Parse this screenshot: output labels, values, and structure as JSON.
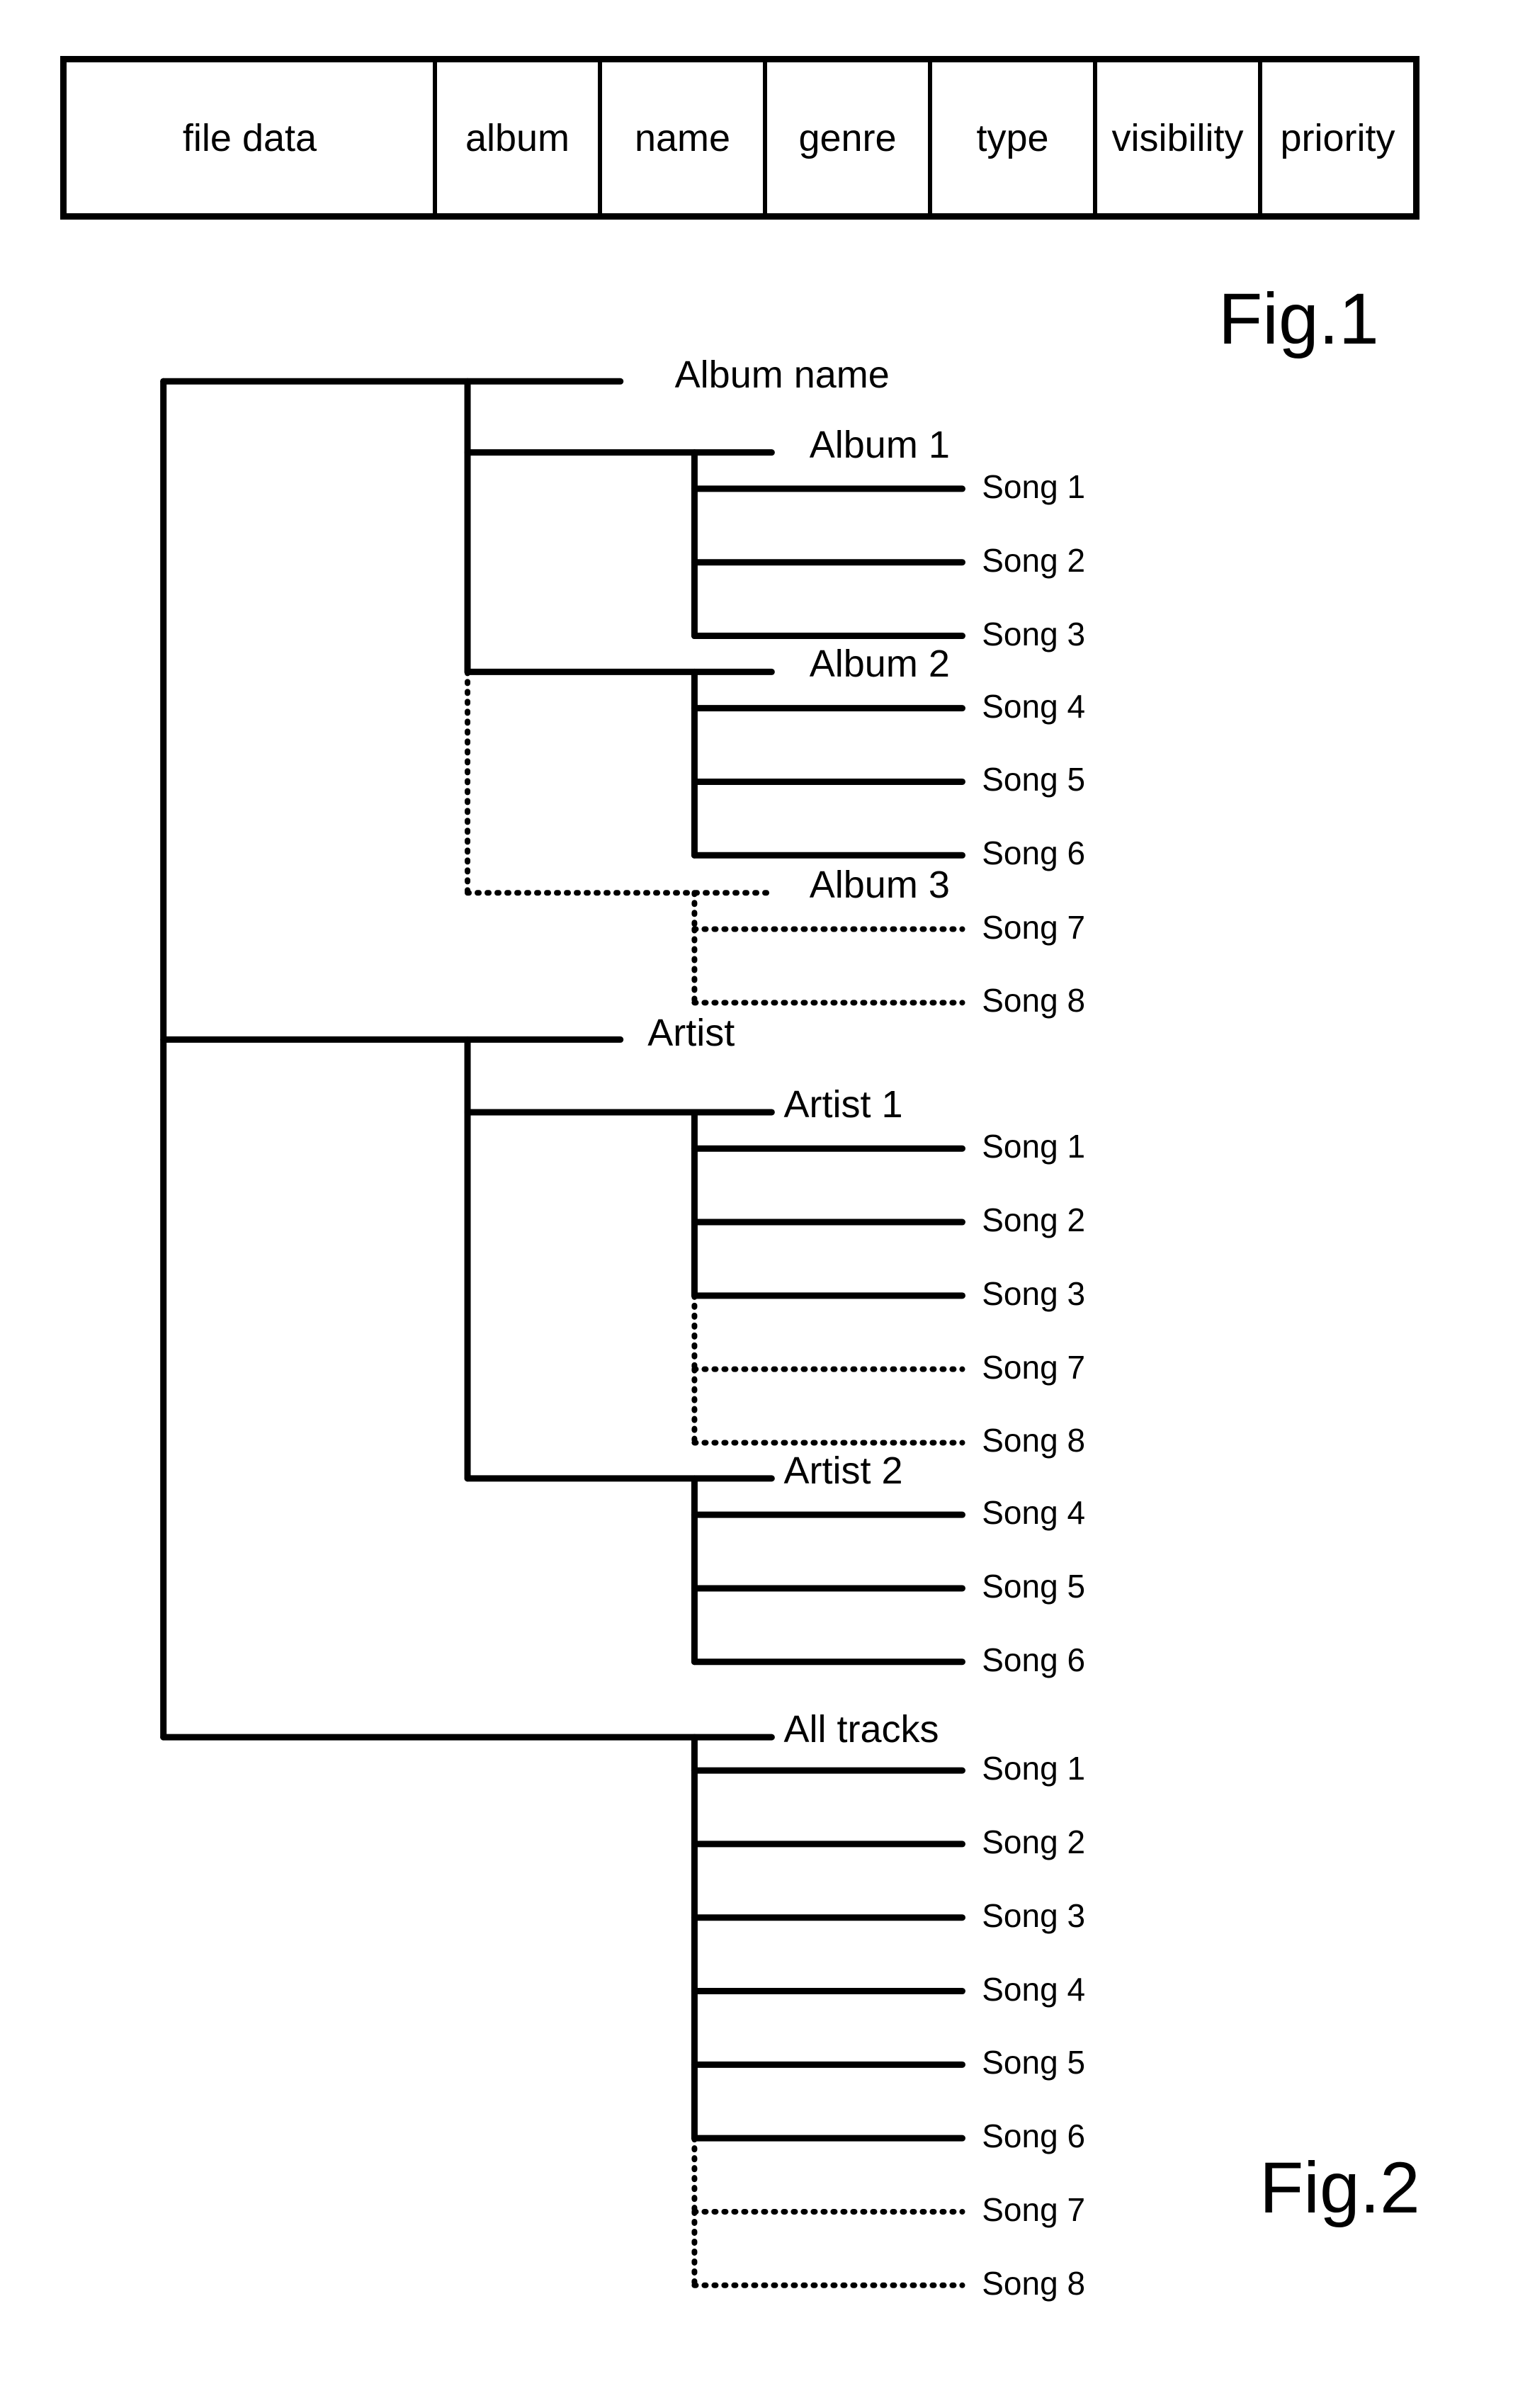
{
  "fig1": {
    "caption": "Fig.1",
    "fields": [
      "file data",
      "album",
      "name",
      "genre",
      "type",
      "visibility",
      "priority"
    ]
  },
  "fig2": {
    "caption": "Fig.2",
    "root": {
      "children": [
        {
          "label": "Album name",
          "children": [
            {
              "label": "Album 1",
              "dashed": false,
              "children": [
                {
                  "label": "Song 1",
                  "dashed": false
                },
                {
                  "label": "Song 2",
                  "dashed": false
                },
                {
                  "label": "Song 3",
                  "dashed": false
                }
              ]
            },
            {
              "label": "Album 2",
              "dashed": false,
              "children": [
                {
                  "label": "Song 4",
                  "dashed": false
                },
                {
                  "label": "Song 5",
                  "dashed": false
                },
                {
                  "label": "Song 6",
                  "dashed": false
                }
              ]
            },
            {
              "label": "Album 3",
              "dashed": true,
              "children": [
                {
                  "label": "Song 7",
                  "dashed": true
                },
                {
                  "label": "Song 8",
                  "dashed": true
                }
              ]
            }
          ]
        },
        {
          "label": "Artist",
          "children": [
            {
              "label": "Artist 1",
              "dashed": false,
              "children": [
                {
                  "label": "Song 1",
                  "dashed": false
                },
                {
                  "label": "Song 2",
                  "dashed": false
                },
                {
                  "label": "Song 3",
                  "dashed": false
                },
                {
                  "label": "Song 7",
                  "dashed": true
                },
                {
                  "label": "Song 8",
                  "dashed": true
                }
              ]
            },
            {
              "label": "Artist 2",
              "dashed": false,
              "children": [
                {
                  "label": "Song 4",
                  "dashed": false
                },
                {
                  "label": "Song 5",
                  "dashed": false
                },
                {
                  "label": "Song 6",
                  "dashed": false
                }
              ]
            }
          ]
        },
        {
          "label": "All tracks",
          "children": [
            {
              "label": "Song 1",
              "dashed": false
            },
            {
              "label": "Song 2",
              "dashed": false
            },
            {
              "label": "Song 3",
              "dashed": false
            },
            {
              "label": "Song 4",
              "dashed": false
            },
            {
              "label": "Song 5",
              "dashed": false
            },
            {
              "label": "Song 6",
              "dashed": false
            },
            {
              "label": "Song 7",
              "dashed": true
            },
            {
              "label": "Song 8",
              "dashed": true
            }
          ]
        }
      ]
    }
  }
}
